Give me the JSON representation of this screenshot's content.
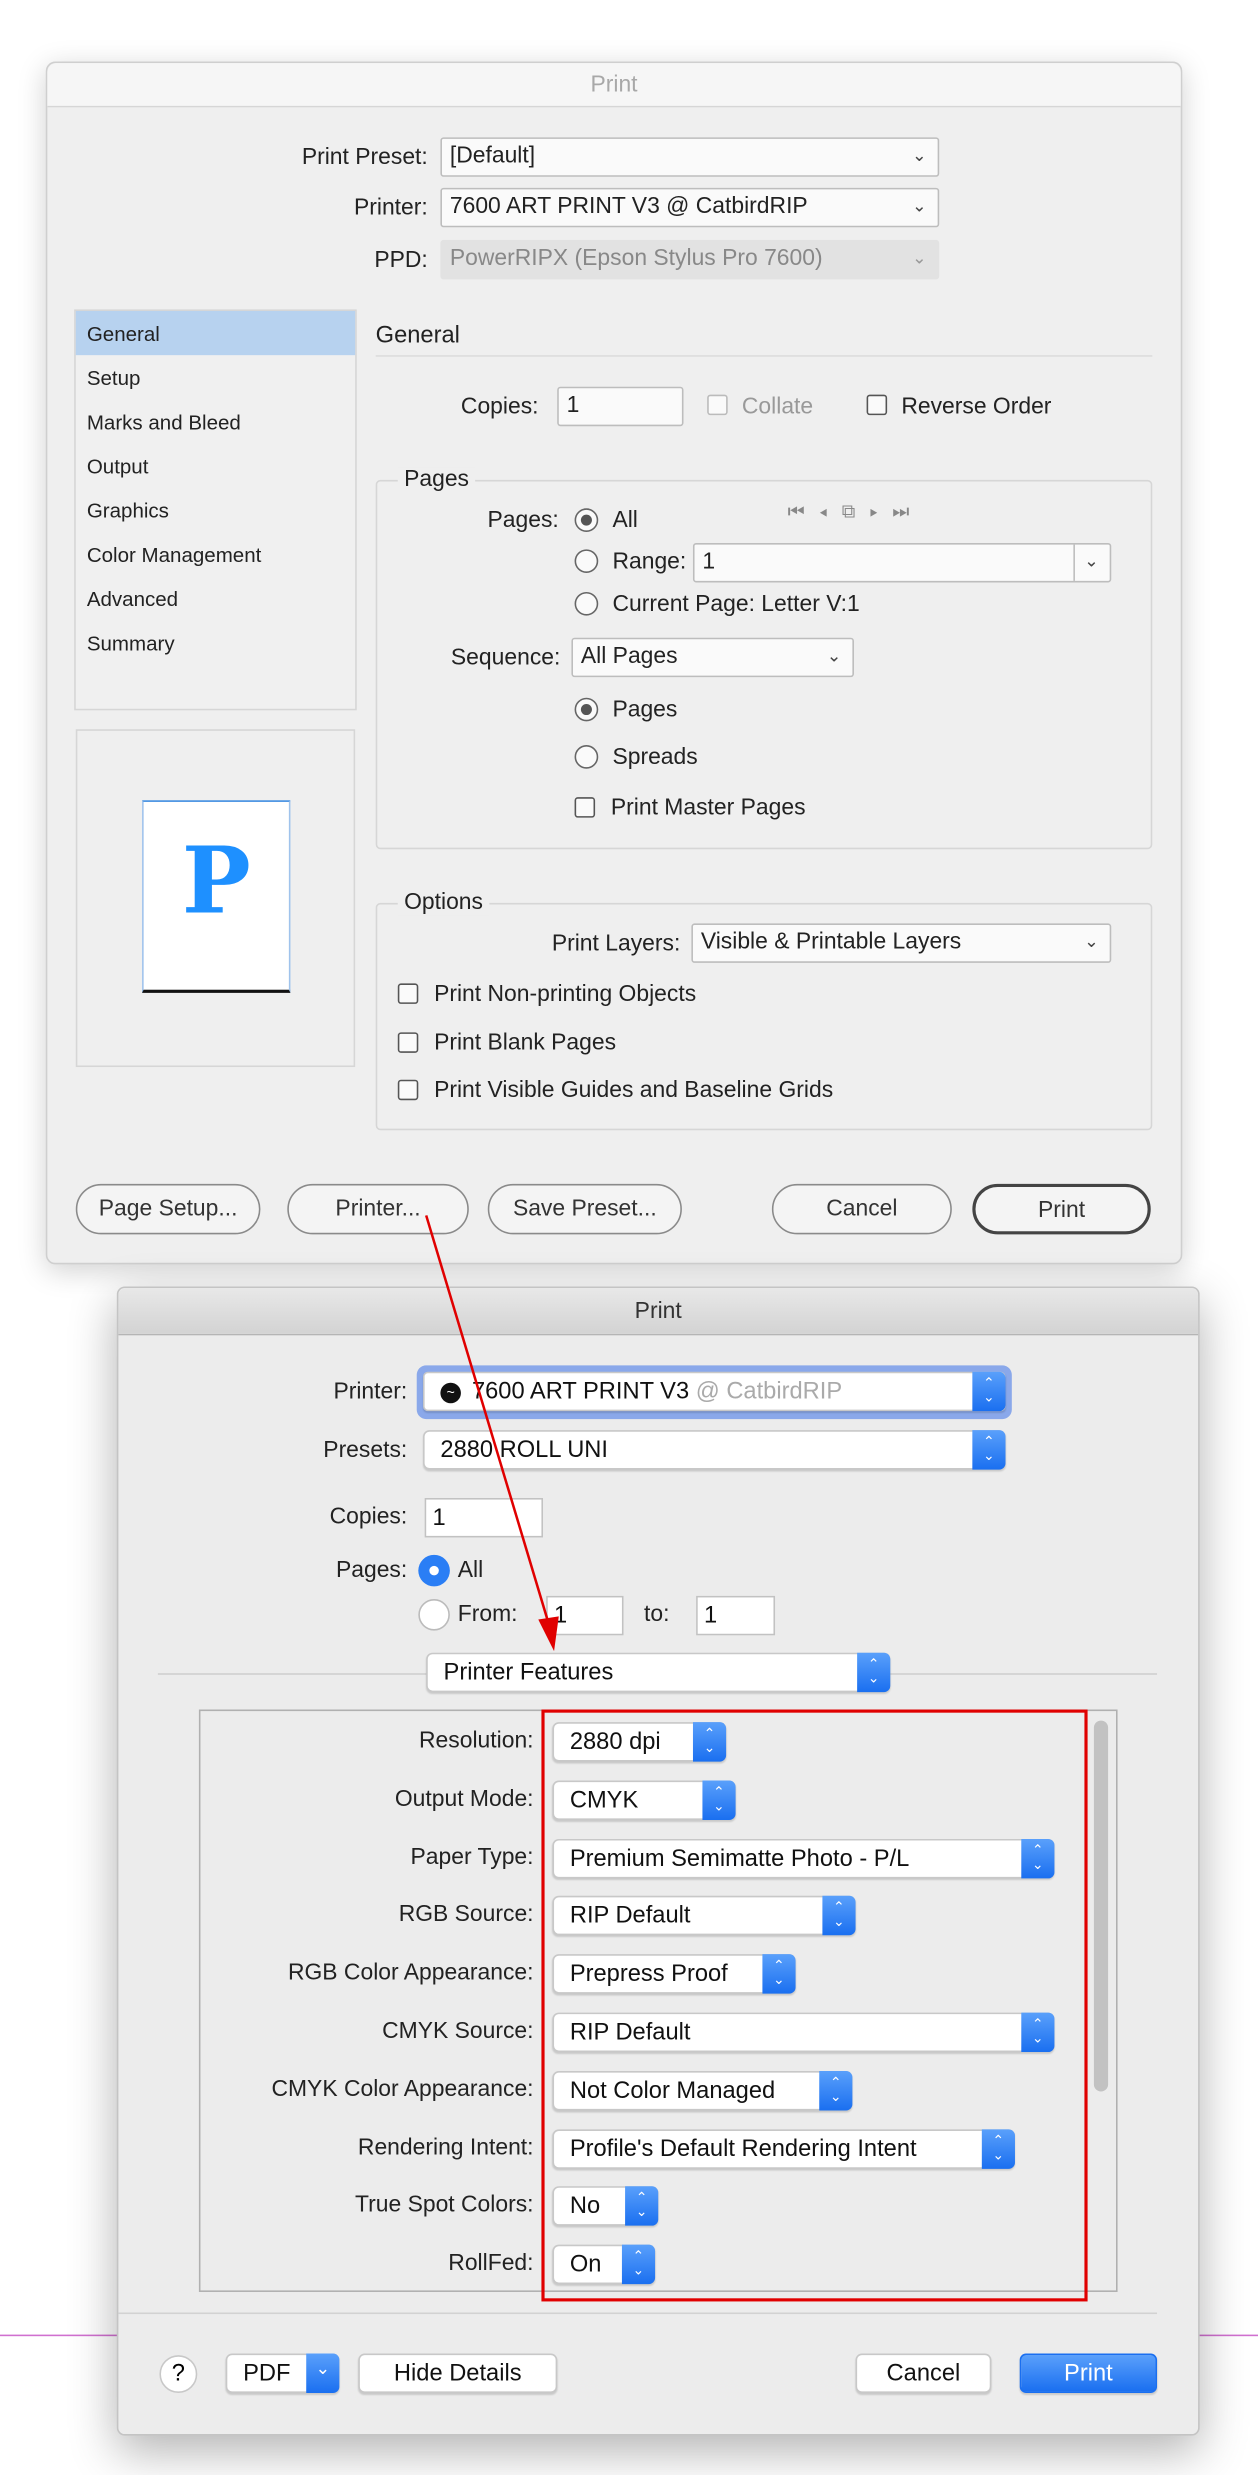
{
  "dialog1": {
    "title": "Print",
    "print_preset_label": "Print Preset:",
    "print_preset_value": "[Default]",
    "printer_label": "Printer:",
    "printer_value": "7600 ART PRINT V3 @ CatbirdRIP",
    "ppd_label": "PPD:",
    "ppd_value": "PowerRIPX (Epson Stylus Pro 7600)",
    "sidebar": [
      "General",
      "Setup",
      "Marks and Bleed",
      "Output",
      "Graphics",
      "Color Management",
      "Advanced",
      "Summary"
    ],
    "preview_letter": "P",
    "section_title": "General",
    "copies_label": "Copies:",
    "copies_value": "1",
    "collate_label": "Collate",
    "reverse_order_label": "Reverse Order",
    "pages_group": "Pages",
    "pages_label": "Pages:",
    "all_label": "All",
    "range_label": "Range:",
    "range_value": "1",
    "current_page_label": "Current Page: Letter V:1",
    "sequence_label": "Sequence:",
    "sequence_value": "All Pages",
    "pages_radio": "Pages",
    "spreads_radio": "Spreads",
    "print_master_pages": "Print Master Pages",
    "options_group": "Options",
    "print_layers_label": "Print Layers:",
    "print_layers_value": "Visible & Printable Layers",
    "options": [
      "Print Non-printing Objects",
      "Print Blank Pages",
      "Print Visible Guides and Baseline Grids"
    ],
    "buttons": {
      "page_setup": "Page Setup...",
      "printer": "Printer...",
      "save_preset": "Save Preset...",
      "cancel": "Cancel",
      "print": "Print"
    }
  },
  "dialog2": {
    "title": "Print",
    "printer_label": "Printer:",
    "printer_name": "7600 ART PRINT V3",
    "printer_host": "@ CatbirdRIP",
    "presets_label": "Presets:",
    "presets_value": "2880 ROLL UNI",
    "copies_label": "Copies:",
    "copies_value": "1",
    "pages_label": "Pages:",
    "all_label": "All",
    "from_label": "From:",
    "from_value": "1",
    "to_label": "to:",
    "to_value": "1",
    "panel_value": "Printer Features",
    "features": [
      {
        "label": "Resolution:",
        "value": "2880 dpi"
      },
      {
        "label": "Output Mode:",
        "value": "CMYK"
      },
      {
        "label": "Paper Type:",
        "value": "Premium Semimatte Photo - P/L"
      },
      {
        "label": "RGB Source:",
        "value": "RIP Default"
      },
      {
        "label": "RGB Color Appearance:",
        "value": "Prepress Proof"
      },
      {
        "label": "CMYK Source:",
        "value": "RIP Default"
      },
      {
        "label": "CMYK Color Appearance:",
        "value": "Not Color Managed"
      },
      {
        "label": "Rendering Intent:",
        "value": "Profile's Default Rendering Intent"
      },
      {
        "label": "True Spot Colors:",
        "value": "No"
      },
      {
        "label": "RollFed:",
        "value": "On"
      }
    ],
    "buttons": {
      "help": "?",
      "pdf": "PDF",
      "hide_details": "Hide Details",
      "cancel": "Cancel",
      "print": "Print"
    }
  },
  "colors": {
    "accent": "#1a6ff0",
    "annotation": "#e00000",
    "selection": "#b7d2ef",
    "preview_letter": "#1e90ff"
  }
}
